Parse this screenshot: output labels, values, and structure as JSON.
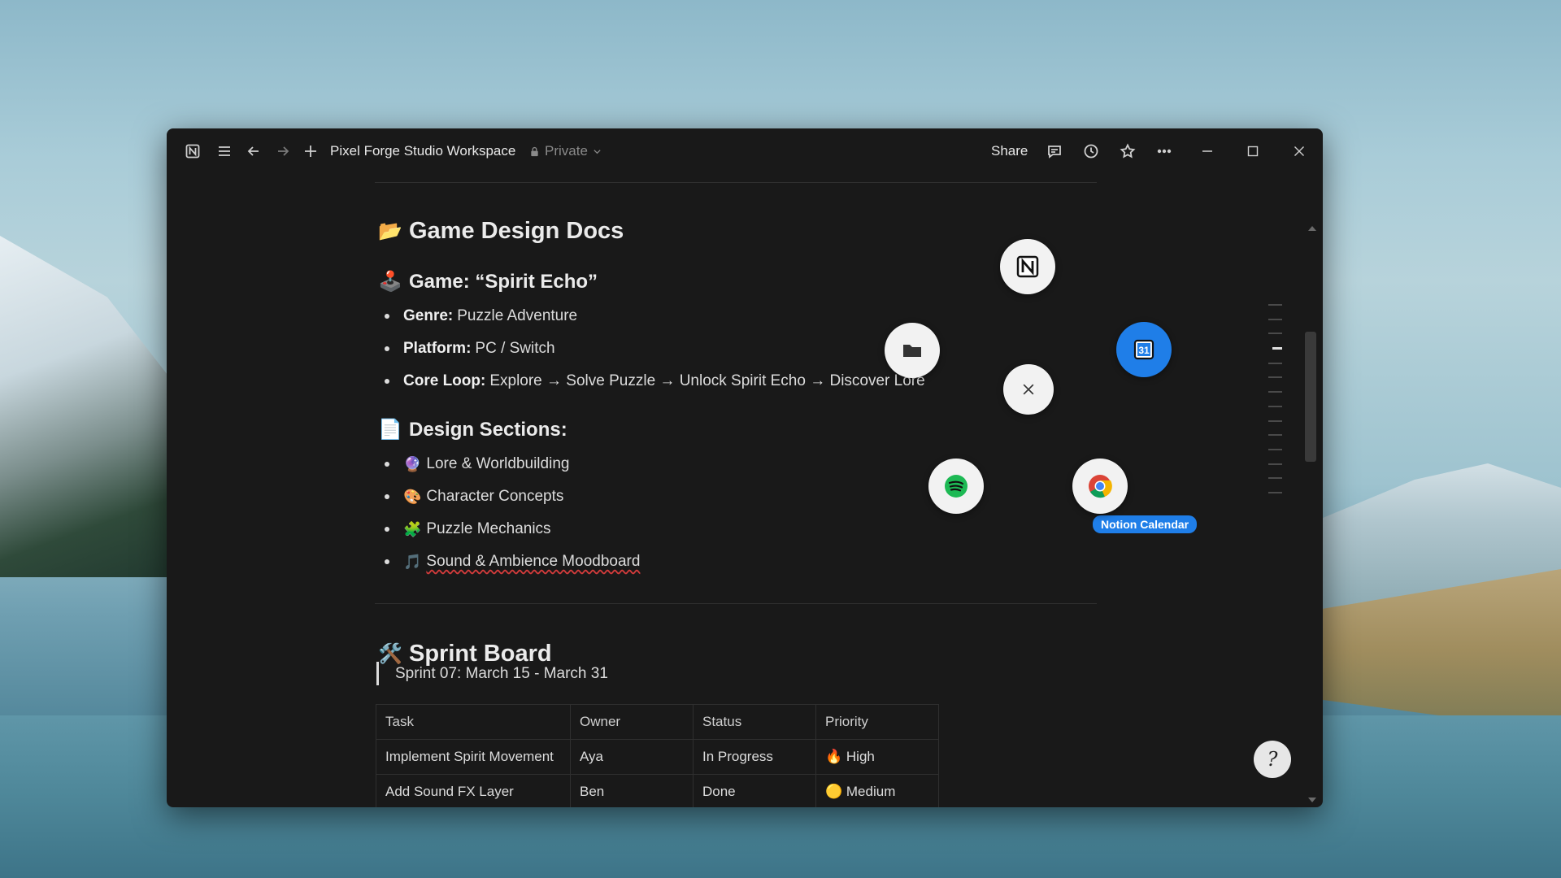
{
  "window": {
    "workspace_title": "Pixel Forge Studio Workspace",
    "privacy": "Private",
    "share_label": "Share"
  },
  "doc": {
    "title": "Game Design Docs",
    "title_icon": "folder",
    "game": {
      "heading": "Game: “Spirit Echo”",
      "icon": "joystick",
      "bullets": [
        {
          "label": "Genre:",
          "value": "Puzzle Adventure"
        },
        {
          "label": "Platform:",
          "value": "PC / Switch"
        },
        {
          "label": "Core Loop:",
          "value": "Explore → Solve Puzzle → Unlock Spirit Echo → Discover Lore"
        }
      ]
    },
    "sections": {
      "heading": "Design Sections:",
      "icon": "page",
      "items": [
        {
          "emoji": "🔮",
          "text": "Lore & Worldbuilding"
        },
        {
          "emoji": "🎨",
          "text": "Character Concepts"
        },
        {
          "emoji": "🧩",
          "text": "Puzzle Mechanics"
        },
        {
          "emoji": "🎵",
          "text": "Sound & Ambience Moodboard"
        }
      ]
    },
    "sprint": {
      "heading": "Sprint Board",
      "icon": "tools",
      "quote": "Sprint 07: March 15 - March 31",
      "columns": [
        "Task",
        "Owner",
        "Status",
        "Priority"
      ],
      "rows": [
        [
          "Implement Spirit Movement",
          "Aya",
          "In Progress",
          "🔥 High"
        ],
        [
          "Add Sound FX Layer",
          "Ben",
          "Done",
          "🟡 Medium"
        ]
      ]
    }
  },
  "launcher": {
    "tooltip": "Notion Calendar",
    "apps": [
      "notion-app",
      "files",
      "close",
      "notion-calendar",
      "spotify",
      "chrome"
    ]
  },
  "help_glyph": "?"
}
